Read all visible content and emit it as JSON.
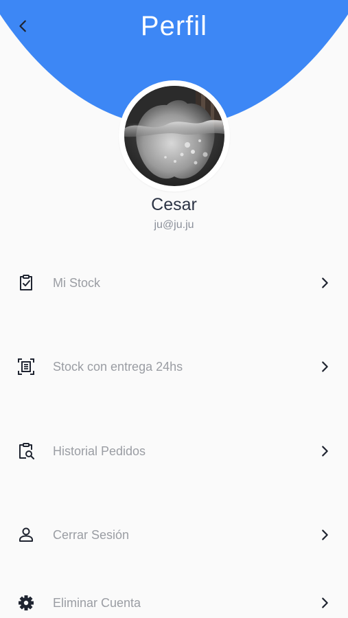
{
  "header": {
    "title": "Perfil",
    "accent_color": "#3d87f5"
  },
  "profile": {
    "name": "Cesar",
    "email": "ju@ju.ju",
    "avatar_description": "apple-splash-photo"
  },
  "menu": {
    "items": [
      {
        "label": "Mi Stock",
        "icon": "clipboard-check-icon"
      },
      {
        "label": "Stock con entrega 24hs",
        "icon": "document-scan-icon"
      },
      {
        "label": "Historial Pedidos",
        "icon": "clipboard-search-icon"
      },
      {
        "label": "Cerrar Sesión",
        "icon": "person-icon"
      },
      {
        "label": "Eliminar Cuenta",
        "icon": "gear-icon"
      }
    ]
  }
}
